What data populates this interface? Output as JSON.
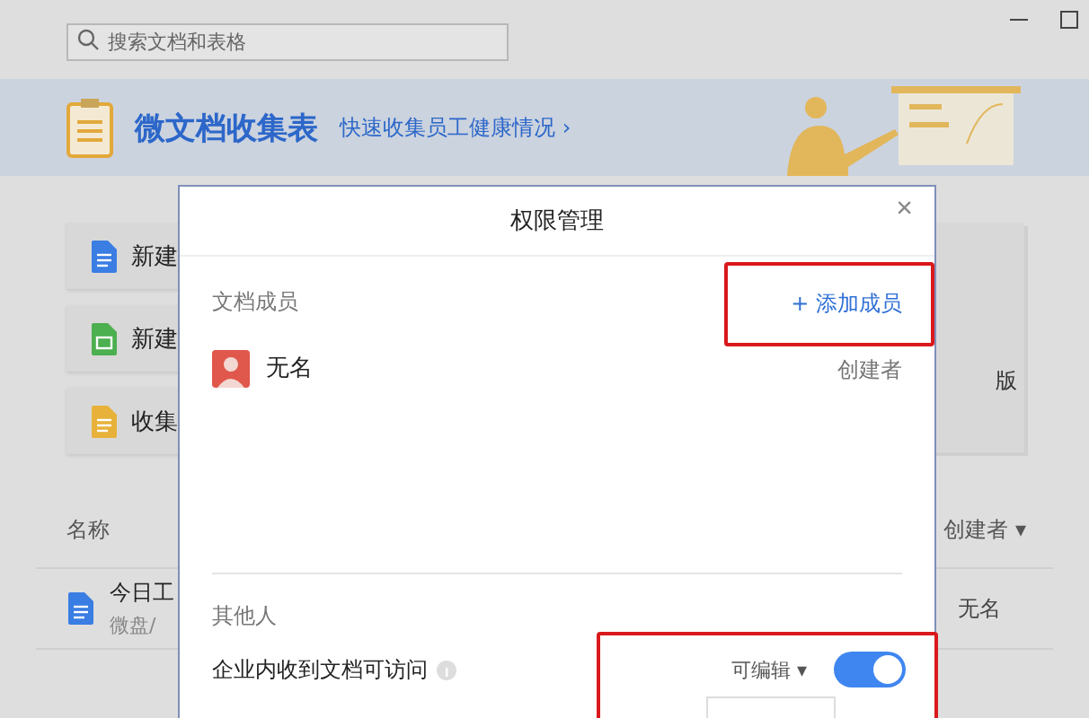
{
  "topbar": {
    "search": {
      "placeholder": "搜索文档和表格"
    }
  },
  "banner": {
    "title": "微文档收集表",
    "link": "快速收集员工健康情况 ›"
  },
  "create_cards": [
    {
      "kind": "doc",
      "label": "新建"
    },
    {
      "kind": "sheet",
      "label": "新建"
    },
    {
      "kind": "form",
      "label": "收集"
    }
  ],
  "template_card": {
    "label": "版"
  },
  "file_list": {
    "columns": [
      {
        "label": "名称"
      },
      {
        "label": "创建者 ▾"
      }
    ],
    "rows": [
      {
        "kind": "doc",
        "name": "今日工",
        "path": "微盘/",
        "creator": "无名"
      }
    ]
  },
  "dialog": {
    "title": "权限管理",
    "close": "×",
    "members_section": {
      "label": "文档成员",
      "add_member": {
        "label": "+ 添加成员",
        "highlighted": true
      },
      "members": [
        {
          "name": "无名",
          "role": "创建者"
        }
      ]
    },
    "others_section": {
      "label": "其他人",
      "access": {
        "label": "企业内收到文档可访问",
        "permission": "可编辑 ▾",
        "on": true,
        "highlighted": true
      }
    }
  }
}
